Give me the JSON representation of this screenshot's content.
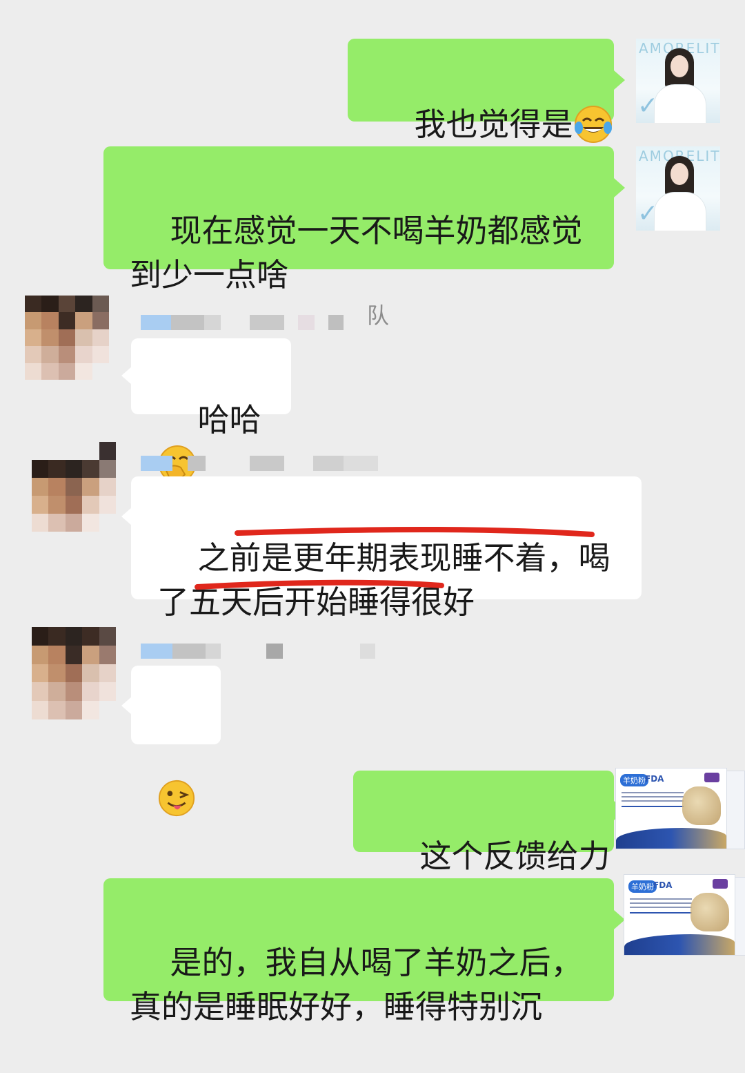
{
  "messages": [
    {
      "id": "m1",
      "direction": "out",
      "text": "我也觉得是",
      "emoji": "tears-of-joy"
    },
    {
      "id": "m2",
      "direction": "out",
      "text": "现在感觉一天不喝羊奶都感觉\n到少一点啥"
    },
    {
      "id": "m3",
      "direction": "in",
      "name_suffix": "队",
      "text": "哈哈",
      "emoji": "hand-over-mouth"
    },
    {
      "id": "m4",
      "direction": "in",
      "text": "之前是更年期表现睡不着，喝\n了五天后开始睡得很好"
    },
    {
      "id": "m5",
      "direction": "in",
      "text": "",
      "emoji": "winking-tongue"
    },
    {
      "id": "m6",
      "direction": "out",
      "text": "这个反馈给力"
    },
    {
      "id": "m7",
      "direction": "out",
      "text": "是的，我自从喝了羊奶之后，\n真的是睡眠好好，睡得特别沉"
    }
  ],
  "my_avatar": {
    "logo_text": "AMORELITY"
  },
  "product": {
    "logo_left": "羊奶粉",
    "logo_right": "FDA"
  },
  "colors": {
    "outgoing": "#95ec69",
    "incoming": "#ffffff",
    "background": "#ededed",
    "annotation": "#e0271c"
  }
}
